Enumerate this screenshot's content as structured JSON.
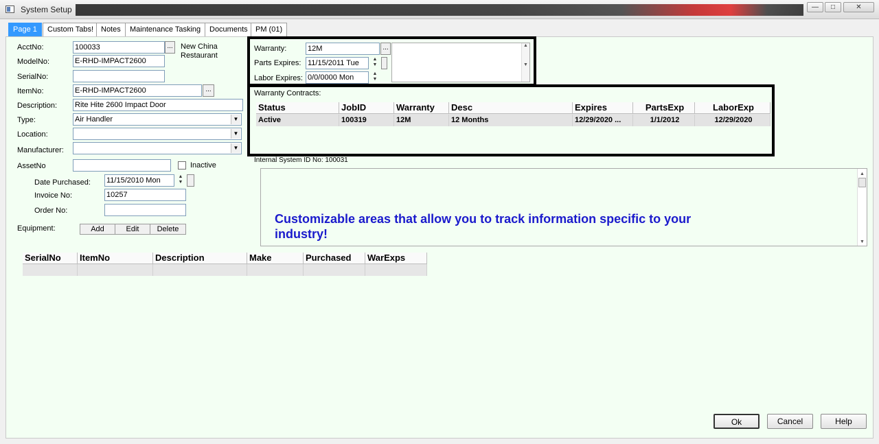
{
  "window": {
    "title": "System Setup",
    "minimize": "—",
    "maximize": "□",
    "close": "✕"
  },
  "tabs": [
    {
      "label": "Page 1"
    },
    {
      "label": "Custom Tabs!"
    },
    {
      "label": "Notes"
    },
    {
      "label": "Maintenance Tasking"
    },
    {
      "label": "Documents"
    },
    {
      "label": "PM (01)"
    }
  ],
  "form": {
    "acctno": {
      "label": "AcctNo:",
      "value": "100033",
      "customer": "New China\nRestaurant"
    },
    "modelno": {
      "label": "ModelNo:",
      "value": "E-RHD-IMPACT2600"
    },
    "serialno": {
      "label": "SerialNo:",
      "value": ""
    },
    "itemno": {
      "label": "ItemNo:",
      "value": "E-RHD-IMPACT2600"
    },
    "description": {
      "label": "Description:",
      "value": "Rite Hite 2600 Impact Door"
    },
    "type": {
      "label": "Type:",
      "value": "Air Handler"
    },
    "location": {
      "label": "Location:",
      "value": ""
    },
    "manufacturer": {
      "label": "Manufacturer:",
      "value": ""
    },
    "assetno": {
      "label": "AssetNo",
      "value": "",
      "inactive_label": "Inactive"
    },
    "date_purchased": {
      "label": "Date Purchased:",
      "value": "11/15/2010 Mon"
    },
    "invoice_no": {
      "label": "Invoice No:",
      "value": "10257"
    },
    "order_no": {
      "label": "Order No:",
      "value": ""
    },
    "equipment": {
      "label": "Equipment:",
      "add": "Add",
      "edit": "Edit",
      "delete": "Delete"
    },
    "ellipsis": "..."
  },
  "warranty": {
    "warranty": {
      "label": "Warranty:",
      "value": "12M"
    },
    "parts_expires": {
      "label": "Parts Expires:",
      "value": "11/15/2011 Tue"
    },
    "labor_expires": {
      "label": "Labor Expires:",
      "value": "0/0/0000 Mon"
    }
  },
  "contracts": {
    "title": "Warranty Contracts:",
    "columns": [
      "Status",
      "JobID",
      "Warranty",
      "Desc",
      "Expires",
      "PartsExp",
      "LaborExp"
    ],
    "rows": [
      {
        "status": "Active",
        "jobid": "100319",
        "warranty": "12M",
        "desc": "12 Months",
        "expires": "12/29/2020 ...",
        "partsexp": "1/1/2012",
        "laborexp": "12/29/2020"
      }
    ]
  },
  "internal_id": "Internal System ID No: 100031",
  "custom_area": {
    "text": "Customizable areas that allow you to track information specific to your industry!"
  },
  "equipment_grid": {
    "columns": [
      "SerialNo",
      "ItemNo",
      "Description",
      "Make",
      "Purchased",
      "WarExps"
    ]
  },
  "buttons": {
    "ok": "Ok",
    "cancel": "Cancel",
    "help": "Help"
  }
}
